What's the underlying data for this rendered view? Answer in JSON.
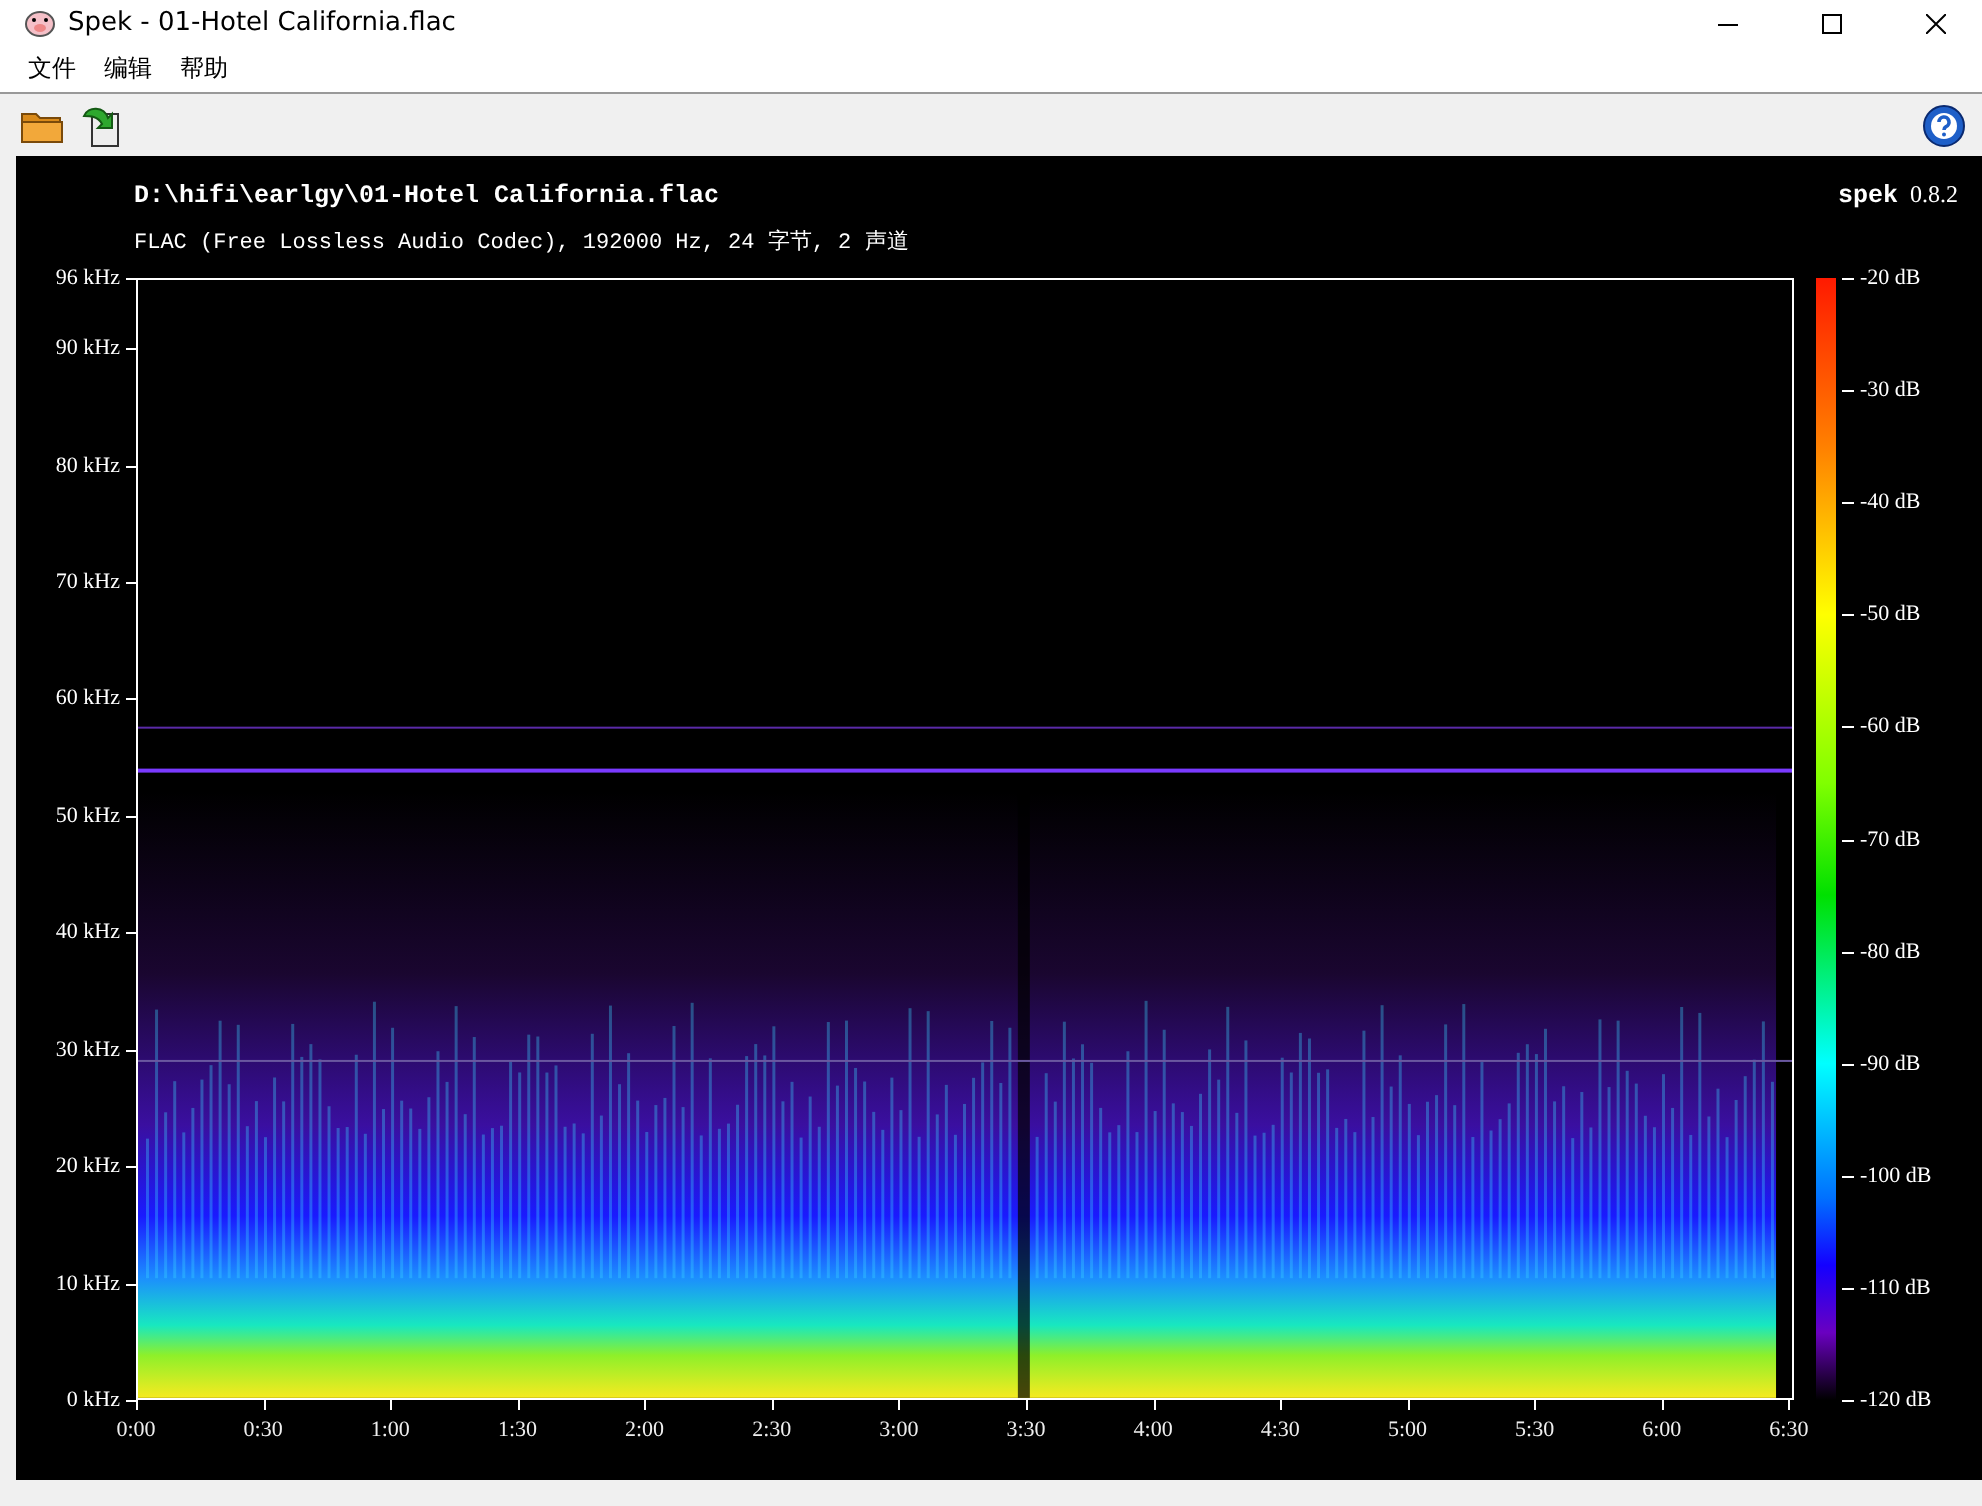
{
  "window": {
    "title": "Spek - 01-Hotel California.flac"
  },
  "menu": [
    {
      "label": "文件"
    },
    {
      "label": "编辑"
    },
    {
      "label": "帮助"
    }
  ],
  "header": {
    "file_path": "D:\\hifi\\earlgy\\01-Hotel California.flac",
    "info": "FLAC (Free Lossless Audio Codec), 192000 Hz, 24 字节, 2 声道",
    "app_name": "spek",
    "version": "0.8.2"
  },
  "frequency_axis": [
    "96 kHz",
    "90 kHz",
    "80 kHz",
    "70 kHz",
    "60 kHz",
    "50 kHz",
    "40 kHz",
    "30 kHz",
    "20 kHz",
    "10 kHz",
    "0 kHz"
  ],
  "time_axis": [
    "0:00",
    "0:30",
    "1:00",
    "1:30",
    "2:00",
    "2:30",
    "3:00",
    "3:30",
    "4:00",
    "4:30",
    "5:00",
    "5:30",
    "6:00",
    "6:30"
  ],
  "db_scale": [
    "-20 dB",
    "-30 dB",
    "-40 dB",
    "-50 dB",
    "-60 dB",
    "-70 dB",
    "-80 dB",
    "-90 dB",
    "-100 dB",
    "-110 dB",
    "-120 dB"
  ]
}
